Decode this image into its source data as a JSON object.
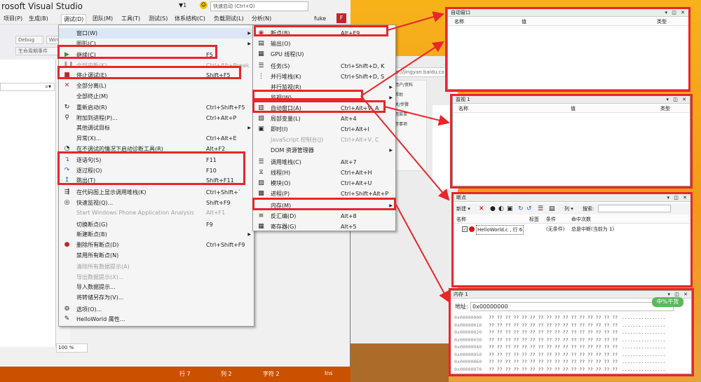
{
  "window": {
    "title": "rosoft Visual Studio",
    "quick_launch": "快速启动 (Ctrl+Q)",
    "notif_count": "1",
    "user": "fuke",
    "avatar": "F"
  },
  "menubar": [
    {
      "label": "项目(P)"
    },
    {
      "label": "生成(B)"
    },
    {
      "label": "调试(D)"
    },
    {
      "label": "团队(M)"
    },
    {
      "label": "工具(T)"
    },
    {
      "label": "测试(S)"
    },
    {
      "label": "体系结构(C)"
    },
    {
      "label": "负载测试(L)"
    },
    {
      "label": "分析(N)"
    }
  ],
  "toolbar": {
    "config": "Debug",
    "platform": "Win",
    "events": "生命周期事件"
  },
  "debug_menu": [
    {
      "label": "窗口(W)",
      "shortcut": "",
      "icon": "",
      "submenu": true,
      "highlight": true,
      "disabled": false
    },
    {
      "label": "图形(C)",
      "shortcut": "",
      "icon": "",
      "submenu": true,
      "disabled": false
    },
    {
      "label": "继续(C)",
      "shortcut": "F5",
      "icon": "play",
      "disabled": false
    },
    {
      "label": "全部中断(K)",
      "shortcut": "Ctrl+Alt+Break",
      "icon": "pause",
      "disabled": true
    },
    {
      "label": "停止调试(E)",
      "shortcut": "Shift+F5",
      "icon": "stop",
      "disabled": false
    },
    {
      "label": "全部分离(L)",
      "shortcut": "",
      "icon": "x",
      "disabled": false
    },
    {
      "label": "全部终止(M)",
      "shortcut": "",
      "icon": "",
      "disabled": false
    },
    {
      "label": "重新启动(R)",
      "shortcut": "Ctrl+Shift+F5",
      "icon": "restart",
      "disabled": false
    },
    {
      "label": "附加到进程(P)...",
      "shortcut": "Ctrl+Alt+P",
      "icon": "attach",
      "disabled": false
    },
    {
      "label": "其他调试目标",
      "shortcut": "",
      "icon": "",
      "submenu": true,
      "disabled": false
    },
    {
      "label": "异常(X)...",
      "shortcut": "Ctrl+Alt+E",
      "icon": "",
      "disabled": false
    },
    {
      "label": "在不调试的情况下启动诊断工具(R)",
      "shortcut": "Alt+F2",
      "icon": "diag",
      "disabled": false
    },
    {
      "label": "逐语句(S)",
      "shortcut": "F11",
      "icon": "step-into",
      "disabled": false
    },
    {
      "label": "逐过程(O)",
      "shortcut": "F10",
      "icon": "step-over",
      "disabled": false
    },
    {
      "label": "跳出(T)",
      "shortcut": "Shift+F11",
      "icon": "step-out",
      "disabled": false
    },
    {
      "label": "在代码图上显示调用堆栈(K)",
      "shortcut": "Ctrl+Shift+`",
      "icon": "codemap",
      "disabled": false
    },
    {
      "label": "快速监视(Q)...",
      "shortcut": "Shift+F9",
      "icon": "quickwatch",
      "disabled": false
    },
    {
      "label": "Start Windows Phone Application Analysis",
      "shortcut": "Alt+F1",
      "icon": "",
      "disabled": true
    },
    {
      "label": "切换断点(G)",
      "shortcut": "F9",
      "icon": "",
      "disabled": false
    },
    {
      "label": "新建断点(B)",
      "shortcut": "",
      "icon": "",
      "submenu": true,
      "disabled": false
    },
    {
      "label": "删除所有断点(D)",
      "shortcut": "Ctrl+Shift+F9",
      "icon": "delbp",
      "disabled": false
    },
    {
      "label": "禁用所有断点(N)",
      "shortcut": "",
      "icon": "",
      "disabled": false
    },
    {
      "label": "清除所有数据提示(A)",
      "shortcut": "",
      "icon": "",
      "disabled": true
    },
    {
      "label": "导出数据提示(X)...",
      "shortcut": "",
      "icon": "",
      "disabled": true
    },
    {
      "label": "导入数据提示...",
      "shortcut": "",
      "icon": "",
      "disabled": false
    },
    {
      "label": "将转储另存为(V)...",
      "shortcut": "",
      "icon": "",
      "disabled": false
    },
    {
      "label": "选项(O)...",
      "shortcut": "",
      "icon": "gear",
      "disabled": false
    },
    {
      "label": "HelloWorld 属性...",
      "shortcut": "",
      "icon": "wrench",
      "disabled": false
    }
  ],
  "window_menu": [
    {
      "label": "断点(B)",
      "shortcut": "Alt+F9",
      "icon": "bp"
    },
    {
      "label": "输出(O)",
      "shortcut": "",
      "icon": "output"
    },
    {
      "label": "GPU 线程(U)",
      "shortcut": "",
      "icon": "gpu"
    },
    {
      "label": "任务(S)",
      "shortcut": "Ctrl+Shift+D, K",
      "icon": "task"
    },
    {
      "label": "并行堆栈(K)",
      "shortcut": "Ctrl+Shift+D, S",
      "icon": "pstack"
    },
    {
      "label": "并行监视(R)",
      "shortcut": "",
      "icon": "",
      "submenu": true
    },
    {
      "label": "监视(W)",
      "shortcut": "",
      "icon": "",
      "submenu": true
    },
    {
      "label": "自动窗口(A)",
      "shortcut": "Ctrl+Alt+V, A",
      "icon": "autos"
    },
    {
      "label": "局部变量(L)",
      "shortcut": "Alt+4",
      "icon": "locals"
    },
    {
      "label": "即时(I)",
      "shortcut": "Ctrl+Alt+I",
      "icon": "immediate"
    },
    {
      "label": "JavaScript 控制台(J)",
      "shortcut": "Ctrl+Alt+V, C",
      "icon": "",
      "disabled": true
    },
    {
      "label": "DOM 资源管理器",
      "shortcut": "",
      "icon": "",
      "submenu": true
    },
    {
      "label": "调用堆栈(C)",
      "shortcut": "Alt+7",
      "icon": "callstack"
    },
    {
      "label": "线程(H)",
      "shortcut": "Ctrl+Alt+H",
      "icon": "threads"
    },
    {
      "label": "模块(O)",
      "shortcut": "Ctrl+Alt+U",
      "icon": "modules"
    },
    {
      "label": "进程(P)",
      "shortcut": "Ctrl+Shift+Alt+P",
      "icon": "processes"
    },
    {
      "label": "内存(M)",
      "shortcut": "",
      "icon": "",
      "submenu": true
    },
    {
      "label": "反汇编(D)",
      "shortcut": "Alt+8",
      "icon": "disasm"
    },
    {
      "label": "寄存器(G)",
      "shortcut": "Alt+5",
      "icon": "registers"
    }
  ],
  "autos_panel": {
    "title": "自动窗口",
    "columns": [
      "名称",
      "值",
      "类型"
    ]
  },
  "watch_panel": {
    "title": "监视 1",
    "columns": [
      "名称",
      "值",
      "类型"
    ]
  },
  "breakpoints_panel": {
    "title": "断点",
    "new_label": "新建",
    "columns_label": "列",
    "search_label": "搜索:",
    "columns": [
      "名称",
      "标签",
      "条件",
      "命中次数"
    ],
    "rows": [
      {
        "name": "HelloWorld.c , 行 6",
        "label": "",
        "condition": "(无条件)",
        "hits": "总是中断(当前为 1)"
      }
    ]
  },
  "memory_panel": {
    "title": "内存 1",
    "address_label": "地址:",
    "address_value": "0x00000000",
    "rows": [
      {
        "addr": "0x00000000",
        "bytes": "?? ?? ?? ?? ?? ?? ?? ?? ?? ?? ?? ?? ?? ?? ?? ??",
        "ascii": "................"
      },
      {
        "addr": "0x00000010",
        "bytes": "?? ?? ?? ?? ?? ?? ?? ?? ?? ?? ?? ?? ?? ?? ?? ??",
        "ascii": "................"
      },
      {
        "addr": "0x00000020",
        "bytes": "?? ?? ?? ?? ?? ?? ?? ?? ?? ?? ?? ?? ?? ?? ?? ??",
        "ascii": "................"
      },
      {
        "addr": "0x00000030",
        "bytes": "?? ?? ?? ?? ?? ?? ?? ?? ?? ?? ?? ?? ?? ?? ?? ??",
        "ascii": "................"
      },
      {
        "addr": "0x00000040",
        "bytes": "?? ?? ?? ?? ?? ?? ?? ?? ?? ?? ?? ?? ?? ?? ?? ??",
        "ascii": "................"
      },
      {
        "addr": "0x00000050",
        "bytes": "?? ?? ?? ?? ?? ?? ?? ?? ?? ?? ?? ?? ?? ?? ?? ??",
        "ascii": "................"
      },
      {
        "addr": "0x00000060",
        "bytes": "?? ?? ?? ?? ?? ?? ?? ?? ?? ?? ?? ?? ?? ?? ?? ??",
        "ascii": "................"
      },
      {
        "addr": "0x00000070",
        "bytes": "?? ?? ?? ?? ?? ?? ?? ?? ?? ?? ?? ?? ?? ?? ?? ??",
        "ascii": "................"
      }
    ]
  },
  "browser": {
    "url": "ttp://jingyan.baidu.co",
    "side_items": [
      "用户/资料",
      "帮助",
      "关/步骤",
      "用菜单",
      "意事项"
    ]
  },
  "status": {
    "line": "行 7",
    "col": "列 2",
    "char": "字符 2",
    "mode": "Ins"
  },
  "zoom": "100 %",
  "watermark": "中%干货",
  "colors": {
    "accent_red": "#e8262b",
    "status_bar": "#ca5100"
  }
}
